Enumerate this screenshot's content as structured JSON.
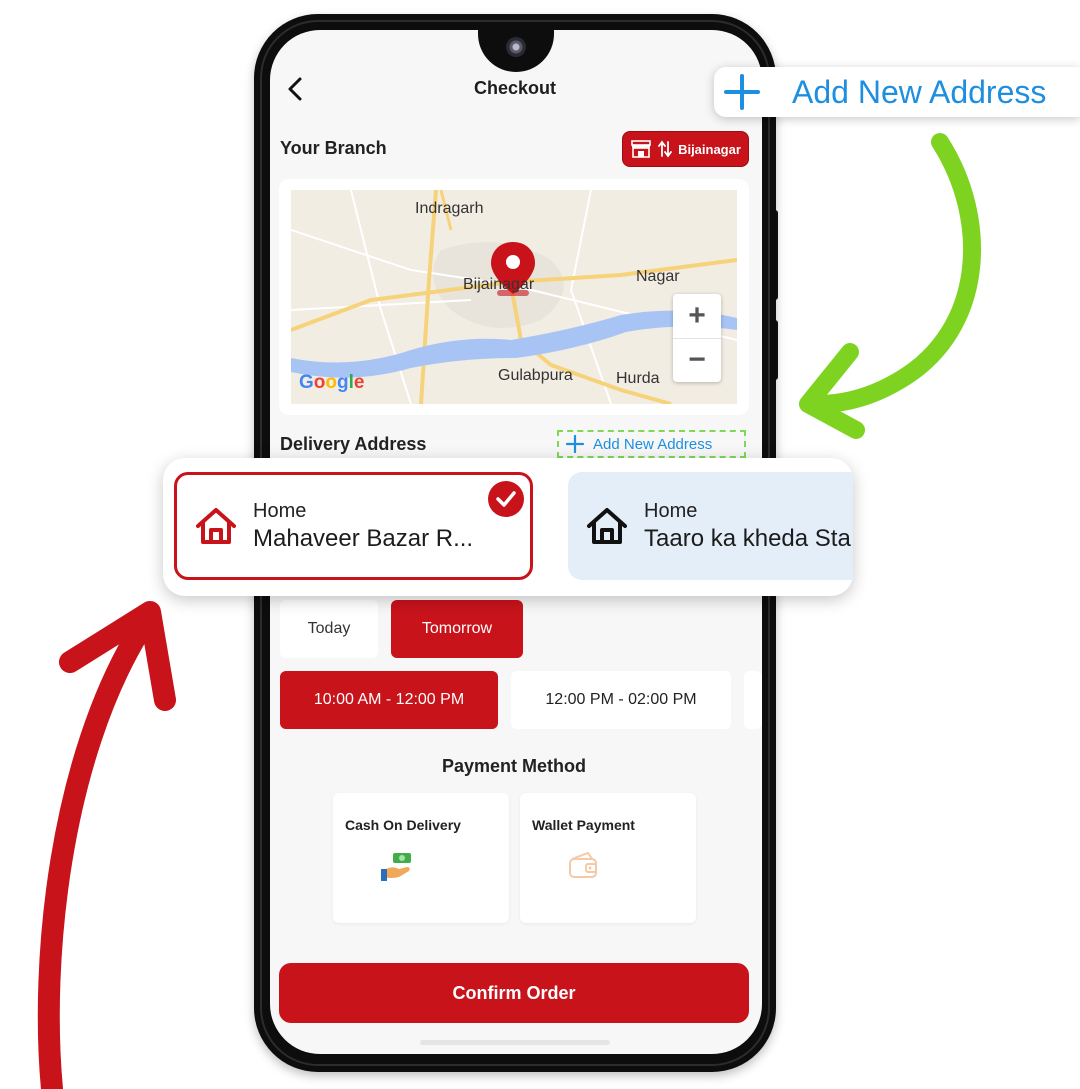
{
  "header": {
    "title": "Checkout",
    "back_icon": "chevron-left-icon"
  },
  "branch": {
    "label": "Your Branch",
    "selected_branch": "Bijainagar",
    "icons": [
      "store-icon",
      "swap-vertical-icon"
    ]
  },
  "map": {
    "places": [
      "Indragarh",
      "Bijainagar",
      "Nagar",
      "Gulabpura",
      "Hurda"
    ],
    "zoom_in": "+",
    "zoom_out": "−",
    "attribution": [
      "G",
      "o",
      "o",
      "g",
      "l",
      "e"
    ],
    "marker_icon": "map-pin-icon"
  },
  "delivery": {
    "label": "Delivery Address",
    "add_new_label": "Add New Address",
    "addresses": [
      {
        "type": "Home",
        "address": "Mahaveer Bazar R...",
        "selected": true,
        "icon": "home-icon"
      },
      {
        "type": "Home",
        "address": "Taaro ka kheda Sta",
        "selected": false,
        "icon": "home-icon"
      }
    ]
  },
  "callout": {
    "add_new_label": "Add New Address",
    "icon": "plus-icon"
  },
  "schedule": {
    "days": [
      "Today",
      "Tomorrow"
    ],
    "selected_day": "Tomorrow",
    "slots": [
      "10:00 AM - 12:00 PM",
      "12:00 PM - 02:00 PM"
    ],
    "selected_slot": "10:00 AM - 12:00 PM"
  },
  "payment": {
    "label": "Payment Method",
    "methods": [
      {
        "name": "Cash On Delivery",
        "icon": "cash-hand-icon"
      },
      {
        "name": "Wallet Payment",
        "icon": "wallet-icon"
      }
    ]
  },
  "actions": {
    "confirm_label": "Confirm Order"
  },
  "colors": {
    "brand_red": "#c8131b",
    "link_blue": "#1e8fe0",
    "arrow_green": "#7ed321",
    "arrow_red": "#c8131b",
    "selected_card_bg": "#ffffff",
    "unselected_card_bg": "#e4eef8"
  }
}
